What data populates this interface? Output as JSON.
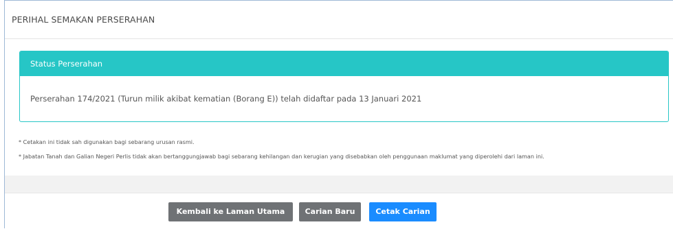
{
  "panel": {
    "title": "PERIHAL SEMAKAN PERSERAHAN"
  },
  "status": {
    "header": "Status Perserahan",
    "message": "Perserahan 174/2021 (Turun milik akibat kematian (Borang E)) telah didaftar pada 13 Januari 2021"
  },
  "notes": [
    "* Cetakan ini tidak sah digunakan bagi sebarang urusan rasmi.",
    "* Jabatan Tanah dan Galian Negeri Perlis tidak akan bertanggungjawab bagi sebarang kehilangan dan kerugian yang disebabkan oleh penggunaan maklumat yang diperolehi dari laman ini."
  ],
  "buttons": {
    "home": "Kembali ke Laman Utama",
    "new_search": "Carian Baru",
    "print": "Cetak Carian"
  },
  "colors": {
    "status_header": "#26c6c6",
    "button_gray": "#6f7275",
    "button_blue": "#1a8cff"
  }
}
